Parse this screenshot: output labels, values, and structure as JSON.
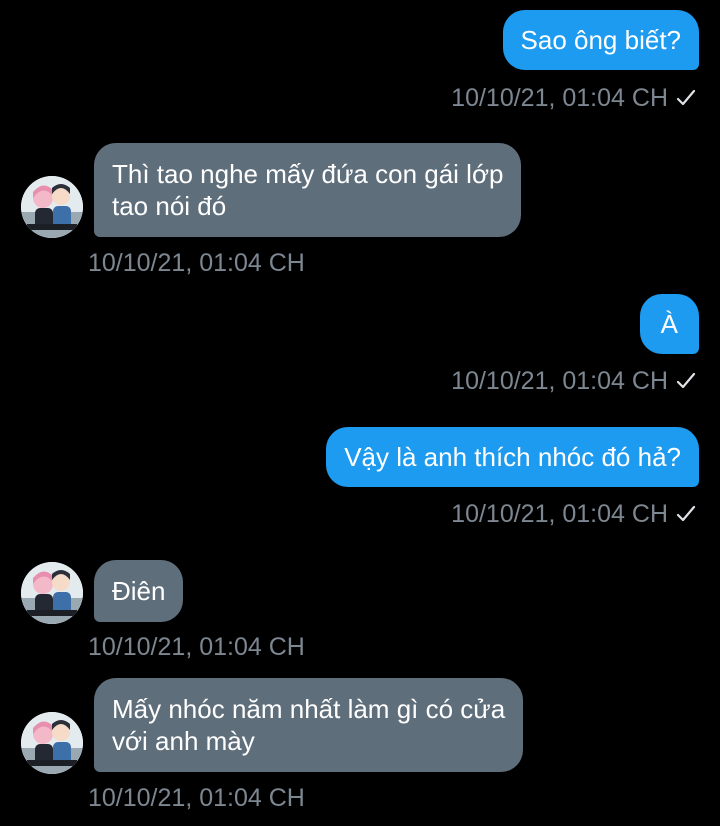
{
  "messages": [
    {
      "direction": "outgoing",
      "text": "Sao ông biết?",
      "timestamp": "10/10/21, 01:04 CH",
      "status_icon": "check-icon"
    },
    {
      "direction": "incoming",
      "lines": [
        "Thì tao nghe mấy đứa con gái lớp",
        "tao nói đó"
      ],
      "timestamp": "10/10/21, 01:04 CH",
      "avatar_icon": "avatar-anime-couple"
    },
    {
      "direction": "outgoing",
      "text": "À",
      "timestamp": "10/10/21, 01:04 CH",
      "status_icon": "check-icon"
    },
    {
      "direction": "outgoing",
      "text": "Vậy là anh thích nhóc đó hả?",
      "timestamp": "10/10/21, 01:04 CH",
      "status_icon": "check-icon"
    },
    {
      "direction": "incoming",
      "text": "Điên",
      "timestamp": "10/10/21, 01:04 CH",
      "avatar_icon": "avatar-anime-couple"
    },
    {
      "direction": "incoming",
      "lines": [
        "Mấy nhóc năm nhất làm gì có cửa",
        "với anh mày"
      ],
      "timestamp": "10/10/21, 01:04 CH",
      "avatar_icon": "avatar-anime-couple"
    }
  ],
  "colors": {
    "background": "#000000",
    "outgoing_bubble": "#1d9bf0",
    "incoming_bubble": "#5f6e7b",
    "timestamp": "#7d8791",
    "text": "#ffffff"
  }
}
